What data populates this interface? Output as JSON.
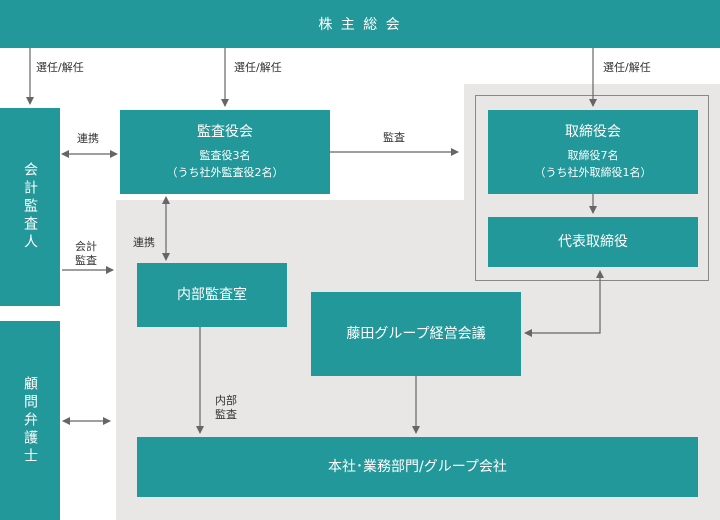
{
  "shareholders": {
    "label": "株 主 総 会"
  },
  "auditor": {
    "label": "会計監査人"
  },
  "legal_advisor": {
    "label": "顧問弁護士"
  },
  "audit_board": {
    "title": "監査役会",
    "sub1": "監査役3名",
    "sub2": "（うち社外監査役2名）"
  },
  "board": {
    "title": "取締役会",
    "sub1": "取締役7名",
    "sub2": "（うち社外取締役1名）"
  },
  "representative": {
    "label": "代表取締役"
  },
  "internal_audit_office": {
    "label": "内部監査室"
  },
  "group_meeting": {
    "label": "藤田グループ経営会議"
  },
  "business_units": {
    "label": "本社･業務部門/グループ会社"
  },
  "edge_labels": {
    "elect_auditor": "選任/解任",
    "elect_audit_board": "選任/解任",
    "elect_board": "選任/解任",
    "cooperation_top": "連携",
    "audit": "監査",
    "accounting_audit_1": "会計",
    "accounting_audit_2": "監査",
    "cooperation_mid": "連携",
    "internal_audit_1": "内部",
    "internal_audit_2": "監査"
  },
  "colors": {
    "node": "#23989a",
    "group_area": "#e8e7e6",
    "frame": "#888888",
    "edge": "#666666"
  }
}
